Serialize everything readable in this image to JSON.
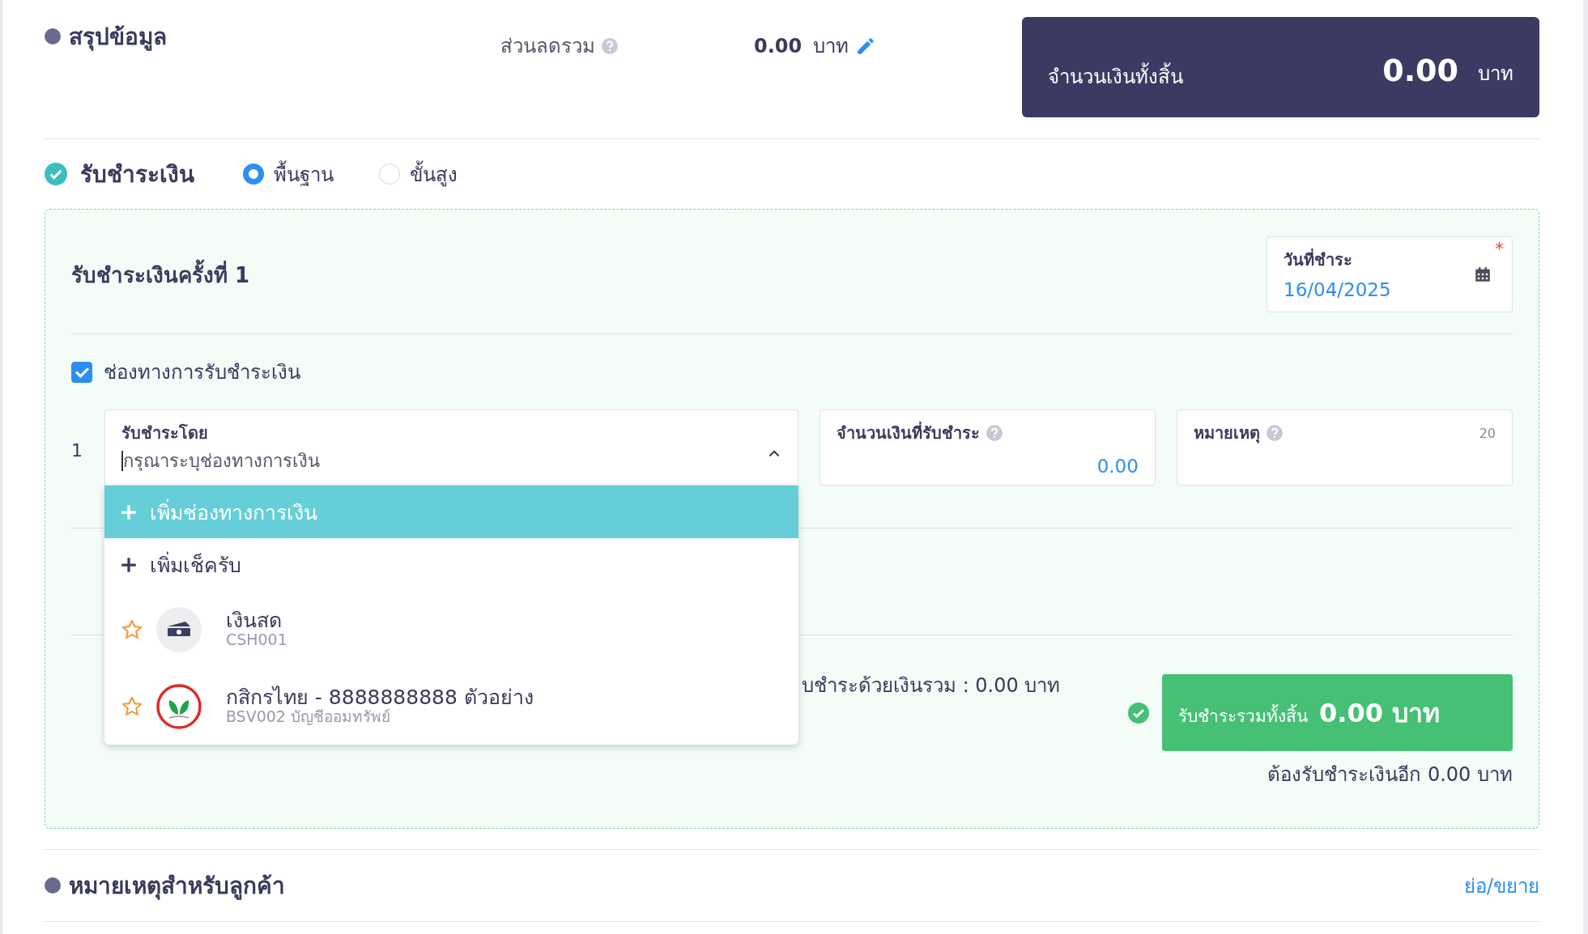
{
  "summary": {
    "title": "สรุปข้อมูล",
    "discount_label": "ส่วนลดรวม",
    "discount_value": "0.00",
    "discount_unit": "บาท",
    "total_label": "จำนวนเงินทั้งสิ้น",
    "total_value": "0.00",
    "total_unit": "บาท"
  },
  "payment": {
    "title": "รับชำระเงิน",
    "checked": true,
    "modes": [
      {
        "label": "พื้นฐาน",
        "selected": true
      },
      {
        "label": "ขั้นสูง",
        "selected": false
      }
    ]
  },
  "installment": {
    "title": "รับชำระเงินครั้งที่ 1",
    "date_label": "วันที่ชำระ",
    "required_mark": "*",
    "date_value": "16/04/2025",
    "channels_label": "ช่องทางการรับชำระเงิน",
    "channels_checked": true,
    "row": {
      "index": "1",
      "method_label": "รับชำระโดย",
      "method_placeholder": "กรุณาระบุช่องทางการเงิน",
      "expanded": true,
      "amount_label": "จำนวนเงินที่รับชำระ",
      "amount_value": "0.00",
      "note_label": "หมายเหตุ",
      "note_limit": "20"
    },
    "dropdown": [
      {
        "kind": "action",
        "label": "เพิ่มช่องทางการเงิน",
        "selected": true
      },
      {
        "kind": "action",
        "label": "เพิ่มเช็ครับ",
        "selected": false
      },
      {
        "kind": "account",
        "label": "เงินสด",
        "sub": "CSH001",
        "selected": false
      },
      {
        "kind": "account",
        "label": "กสิกรไทย - 8888888888 ตัวอย่าง",
        "sub": "BSV002 บัญชีออมทรัพย์",
        "selected": false
      }
    ],
    "partial_total": "บชำระด้วยเงินรวม :  0.00 บาท",
    "grand_label": "รับชำระรวมทั้งสิ้น",
    "grand_value": "0.00 บาท",
    "remaining": "ต้องรับชำระเงินอีก 0.00 บาท"
  },
  "notes_section": {
    "title": "หมายเหตุสำหรับลูกค้า",
    "toggle": "ย่อ/ขยาย"
  }
}
